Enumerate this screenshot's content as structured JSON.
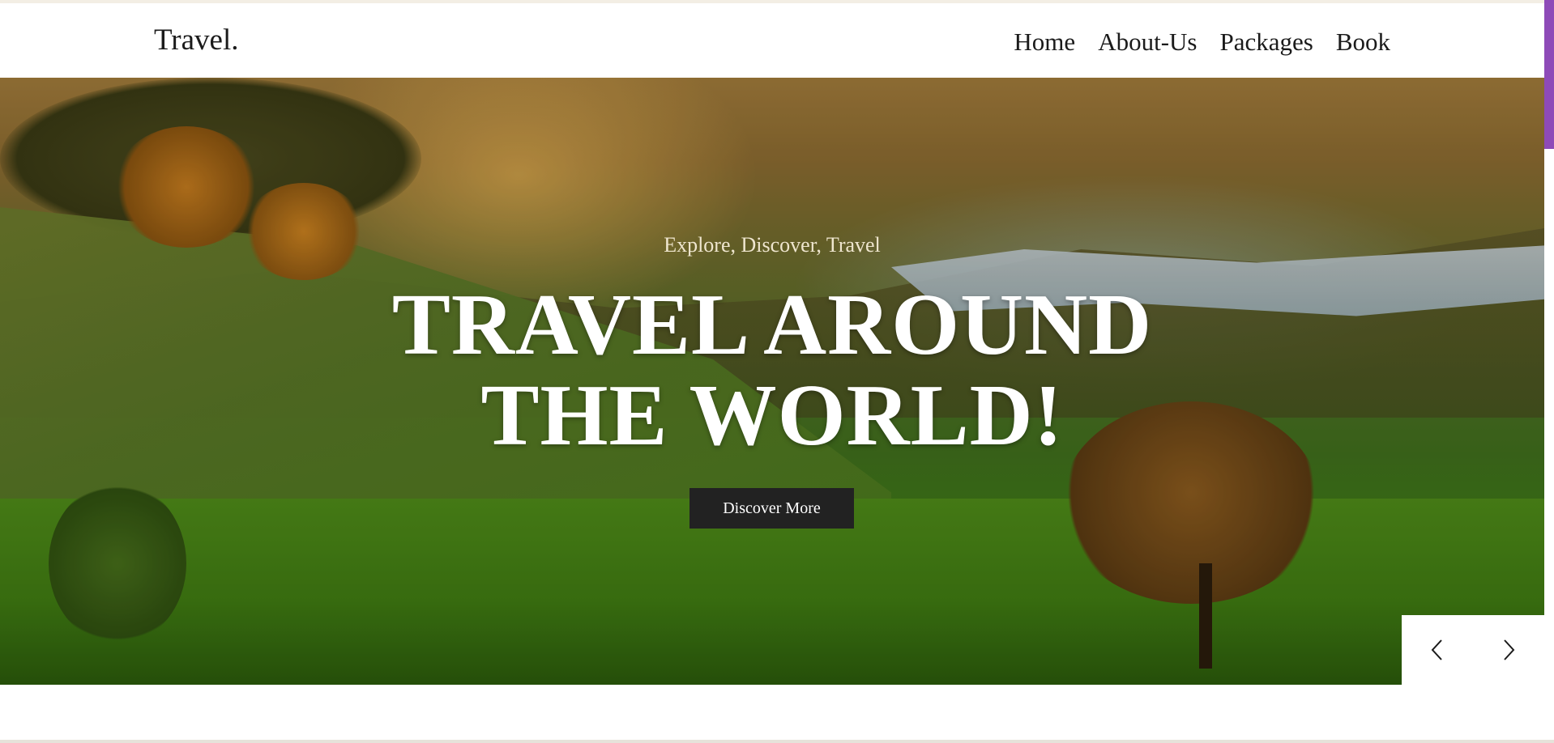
{
  "brand": {
    "logo_text": "Travel."
  },
  "nav": {
    "items": [
      {
        "label": "Home"
      },
      {
        "label": "About-Us"
      },
      {
        "label": "Packages"
      },
      {
        "label": "Book"
      }
    ]
  },
  "hero": {
    "subtitle": "Explore, Discover, Travel",
    "title_line1": "TRAVEL AROUND",
    "title_line2": "THE WORLD!",
    "cta_label": "Discover More"
  },
  "slider": {
    "prev_icon": "chevron-left-icon",
    "next_icon": "chevron-right-icon"
  },
  "colors": {
    "scrollbar_thumb": "#8e4ab8",
    "button_bg": "#222222",
    "text_dark": "#1b1b1b",
    "hero_title": "#ffffff"
  }
}
